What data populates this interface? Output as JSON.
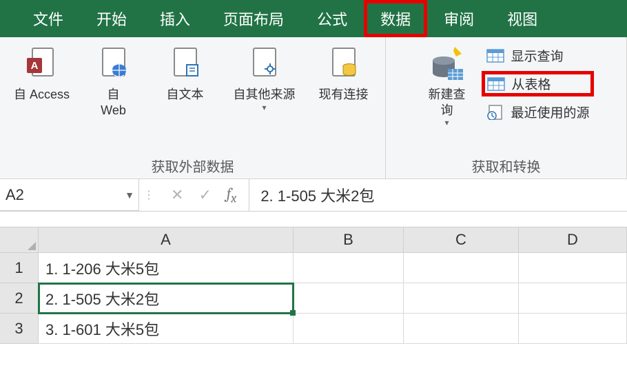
{
  "tabs": {
    "file": "文件",
    "home": "开始",
    "insert": "插入",
    "layout": "页面布局",
    "formulas": "公式",
    "data": "数据",
    "review": "审阅",
    "view": "视图"
  },
  "ribbon": {
    "group1_label": "获取外部数据",
    "group2_label": "获取和转换",
    "from_access": "自 Access",
    "from_web": "自\nWeb",
    "from_text": "自文本",
    "from_other": "自其他来源",
    "existing_conn": "现有连接",
    "new_query": "新建查\n询",
    "show_queries": "显示查询",
    "from_table": "从表格",
    "recent_sources": "最近使用的源"
  },
  "namebox": "A2",
  "formula_value": "2. 1-505 大米2包",
  "columns": {
    "A": "A",
    "B": "B",
    "C": "C",
    "D": "D"
  },
  "rows": {
    "r1": "1",
    "r2": "2",
    "r3": "3"
  },
  "cells": {
    "A1": "1. 1-206 大米5包",
    "A2": "2. 1-505 大米2包",
    "A3": "3. 1-601 大米5包"
  }
}
